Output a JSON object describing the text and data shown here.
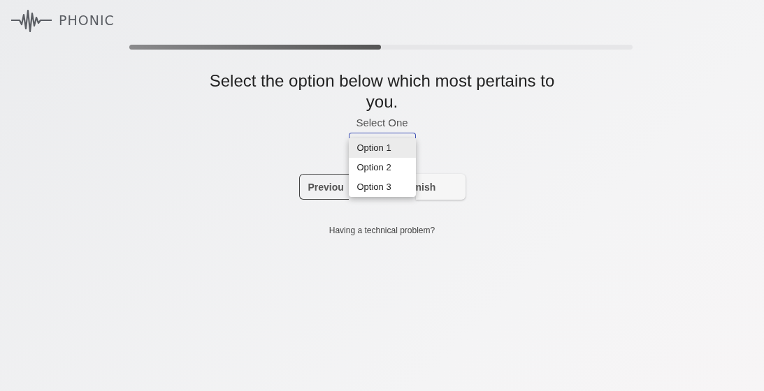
{
  "brand": {
    "name": "PHONIC"
  },
  "progress": {
    "level": 0.5
  },
  "question": {
    "title": "Select the option below which most pertains to you.",
    "select_label": "Select One"
  },
  "menu": {
    "options": [
      {
        "label": "Option 1",
        "selected": true
      },
      {
        "label": "Option 2",
        "selected": false
      },
      {
        "label": "Option 3",
        "selected": false
      }
    ]
  },
  "buttons": [
    {
      "kind": "outline",
      "label": "Previou"
    },
    {
      "kind": "raised",
      "label": "nish"
    }
  ],
  "help_link": "Having a technical problem?"
}
